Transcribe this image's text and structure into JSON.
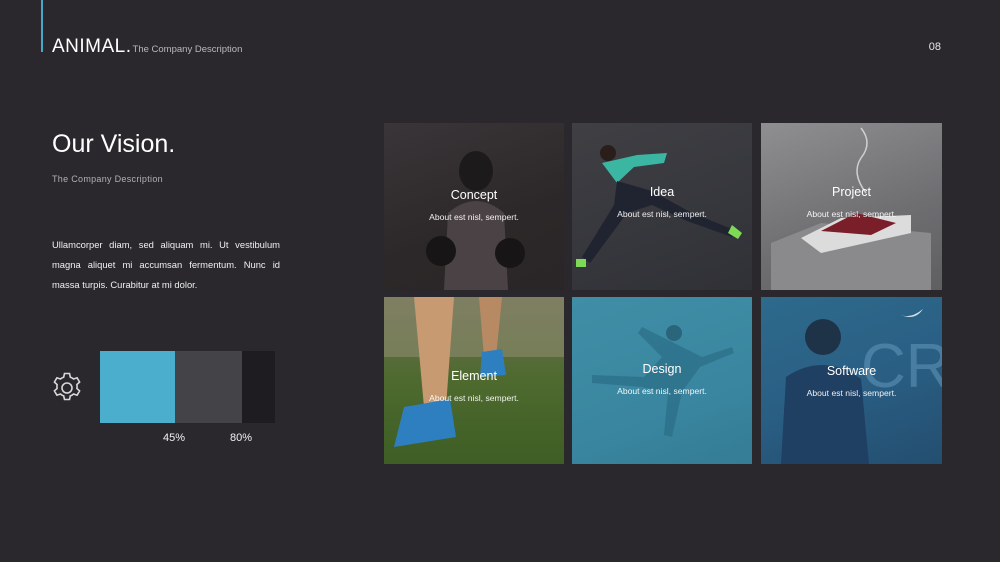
{
  "header": {
    "brand": "ANIMAL.",
    "brand_subtitle": "The Company Description",
    "page_number": "08"
  },
  "main": {
    "title": "Our Vision.",
    "subtitle": "The Company Description",
    "body": "Ullamcorper diam, sed aliquam mi. Ut vestibulum magna aliquet mi accumsan fermentum. Nunc id massa turpis. Curabitur at mi dolor."
  },
  "progress": {
    "icon": "gear-icon",
    "values": [
      45,
      80
    ],
    "labels": [
      "45%",
      "80%"
    ],
    "colors": [
      "#4aaecc",
      "#444347",
      "#1e1c20"
    ]
  },
  "tiles": [
    {
      "label": "Concept",
      "desc": "About est nisl, sempert."
    },
    {
      "label": "Idea",
      "desc": "About est nisl, sempert."
    },
    {
      "label": "Project",
      "desc": "About est nisl, sempert."
    },
    {
      "label": "Element",
      "desc": "About est nisl, sempert."
    },
    {
      "label": "Design",
      "desc": "About est nisl, sempert."
    },
    {
      "label": "Software",
      "desc": "About est nisl, sempert."
    }
  ],
  "colors": {
    "background": "#2a282d",
    "accent": "#48a8c8"
  }
}
